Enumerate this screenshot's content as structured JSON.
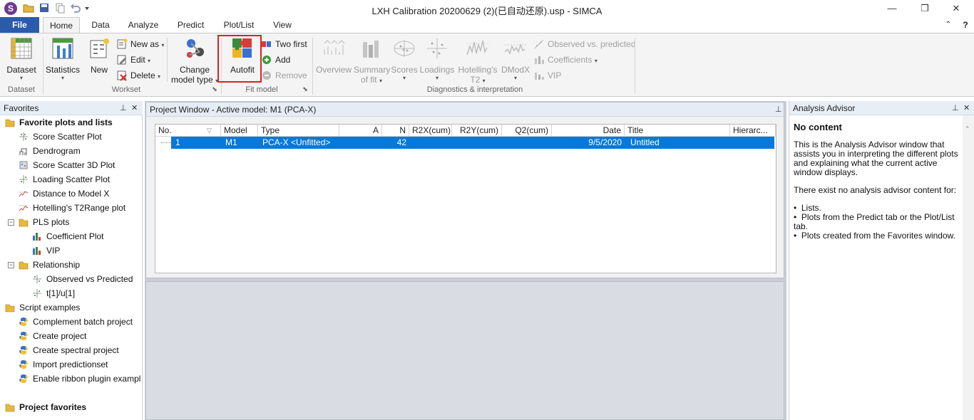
{
  "window": {
    "title": "LXH Calibration 20200629 (2)(已自动还原).usp - SIMCA",
    "app_letter": "S",
    "controls": {
      "minimize": "—",
      "maximize": "❐",
      "close": "✕"
    }
  },
  "tabs": [
    {
      "label": "File"
    },
    {
      "label": "Home"
    },
    {
      "label": "Data"
    },
    {
      "label": "Analyze"
    },
    {
      "label": "Predict"
    },
    {
      "label": "Plot/List"
    },
    {
      "label": "View"
    }
  ],
  "ribbon": {
    "dataset": {
      "label": "Dataset",
      "group": "Dataset"
    },
    "statistics": {
      "label": "Statistics"
    },
    "new": {
      "label": "New"
    },
    "new_as": {
      "label": "New as"
    },
    "edit": {
      "label": "Edit"
    },
    "delete": {
      "label": "Delete"
    },
    "workset_group": "Workset",
    "change_model_type": {
      "line1": "Change",
      "line2": "model type"
    },
    "autofit": {
      "label": "Autofit"
    },
    "two_first": {
      "label": "Two first"
    },
    "add": {
      "label": "Add"
    },
    "remove": {
      "label": "Remove"
    },
    "fit_model_group": "Fit model",
    "overview": {
      "label": "Overview"
    },
    "summary_of_fit": {
      "line1": "Summary",
      "line2": "of fit"
    },
    "scores": {
      "label": "Scores"
    },
    "loadings": {
      "label": "Loadings"
    },
    "hotellings": {
      "line1": "Hotelling's",
      "line2": "T2"
    },
    "dmodx": {
      "label": "DModX"
    },
    "observed_vs_predicted": {
      "label": "Observed vs. predicted"
    },
    "coefficients": {
      "label": "Coefficients"
    },
    "vip": {
      "label": "VIP"
    },
    "diagnostics_group": "Diagnostics & interpretation"
  },
  "favorites": {
    "title": "Favorites",
    "items": [
      {
        "label": "Favorite plots and lists",
        "bold": true
      },
      {
        "label": "Score Scatter Plot"
      },
      {
        "label": "Dendrogram"
      },
      {
        "label": "Score Scatter 3D Plot"
      },
      {
        "label": "Loading Scatter Plot"
      },
      {
        "label": "Distance to Model X"
      },
      {
        "label": "Hotelling's T2Range plot"
      },
      {
        "label": "PLS plots"
      },
      {
        "label": "Coefficient Plot"
      },
      {
        "label": "VIP"
      },
      {
        "label": "Relationship"
      },
      {
        "label": "Observed vs Predicted"
      },
      {
        "label": "t[1]/u[1]"
      },
      {
        "label": "Script examples"
      },
      {
        "label": "Complement batch project"
      },
      {
        "label": "Create project"
      },
      {
        "label": "Create spectral project"
      },
      {
        "label": "Import predictionset"
      },
      {
        "label": "Enable ribbon plugin exampl"
      },
      {
        "label": "Project favorites",
        "bold": true
      }
    ]
  },
  "project_window": {
    "title": "Project Window - Active model: M1 (PCA-X)",
    "columns": [
      "No.",
      "Model",
      "Type",
      "A",
      "N",
      "R2X(cum)",
      "R2Y(cum)",
      "Q2(cum)",
      "Date",
      "Title",
      "Hierarc..."
    ],
    "rows": [
      {
        "no": "1",
        "model": "M1",
        "type": "PCA-X <Unfitted>",
        "a": "",
        "n": "42",
        "r2x": "",
        "r2y": "",
        "q2": "",
        "date": "9/5/2020",
        "title": "Untitled",
        "hier": ""
      }
    ]
  },
  "advisor": {
    "title": "Analysis Advisor",
    "heading": "No content",
    "para1": "This is the Analysis Advisor window that assists you in interpreting the different plots and explaining what the current active window displays.",
    "para2": "There exist no analysis advisor content for:",
    "bullets": [
      "Lists.",
      "Plots from the Predict tab or the Plot/List tab.",
      "Plots created from the Favorites window."
    ]
  },
  "colors": {
    "file_tab": "#2a5caa",
    "selected_row": "#0a78d7",
    "highlight": "#e02020"
  }
}
